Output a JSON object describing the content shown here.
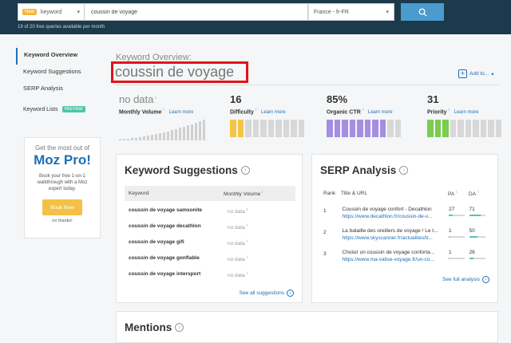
{
  "search": {
    "new_badge": "New",
    "type_value": "keyword",
    "query_value": "coussin de voyage",
    "locale_value": "France - fr-FR",
    "quota_text": "19 of 20 free queries available per month"
  },
  "sidebar": {
    "items": [
      {
        "label": "Keyword Overview"
      },
      {
        "label": "Keyword Suggestions"
      },
      {
        "label": "SERP Analysis"
      }
    ],
    "lists_label": "Keyword Lists",
    "preview_badge": "PREVIEW"
  },
  "promo": {
    "tagline": "Get the most out of",
    "title": "Moz Pro!",
    "text": "Book your free 1-on-1 walkthrough with a Moz expert today.",
    "button": "Book Now",
    "dismiss": "no thanks!"
  },
  "overview": {
    "heading": "Keyword Overview:",
    "keyword": "coussin de voyage",
    "add_to": "Add to..."
  },
  "metrics": {
    "learn_more": "Learn more",
    "monthly_volume": {
      "value": "no data",
      "label": "Monthly Volume"
    },
    "difficulty": {
      "value": "16",
      "label": "Difficulty",
      "filled": 2,
      "total": 10
    },
    "organic_ctr": {
      "value": "85%",
      "label": "Organic CTR",
      "filled": 8,
      "total": 10
    },
    "priority": {
      "value": "31",
      "label": "Priority",
      "filled": 3,
      "total": 10
    }
  },
  "colors": {
    "difficulty": "#f6c445",
    "organic_ctr": "#a58ee2",
    "priority": "#7ccc4e",
    "empty": "#d8d8d8"
  },
  "suggestions": {
    "title": "Keyword Suggestions",
    "col_keyword": "Keyword",
    "col_volume": "Monthly Volume",
    "rows": [
      {
        "keyword": "coussin de voyage samsonite",
        "volume": "no data"
      },
      {
        "keyword": "coussin de voyage decathlon",
        "volume": "no data"
      },
      {
        "keyword": "coussin de voyage gifi",
        "volume": "no data"
      },
      {
        "keyword": "coussin de voyage gonflable",
        "volume": "no data"
      },
      {
        "keyword": "coussin de voyage intersport",
        "volume": "no data"
      }
    ],
    "see_all": "See all suggestions"
  },
  "serp": {
    "title": "SERP Analysis",
    "col_rank": "Rank",
    "col_title": "Title & URL",
    "col_pa": "PA",
    "col_da": "DA",
    "rows": [
      {
        "rank": "1",
        "title": "Coussin de voyage confort - Decathlon",
        "url": "https://www.decathlon.fr/coussin-de-v...",
        "pa": "27",
        "da": "71",
        "pa_level": 0.27,
        "da_level": 0.71
      },
      {
        "rank": "2",
        "title": "La bataille des oreillers de voyage ! Le t...",
        "url": "https://www.skyscanner.fr/actualites/tr...",
        "pa": "1",
        "da": "50",
        "pa_level": 0.01,
        "da_level": 0.5
      },
      {
        "rank": "3",
        "title": "Choisir un coussin de voyage conforta...",
        "url": "https://www.ma-valise-voyage.fr/un-co...",
        "pa": "1",
        "da": "26",
        "pa_level": 0.01,
        "da_level": 0.26
      }
    ],
    "see_full": "See full analysis"
  },
  "mentions": {
    "title": "Mentions"
  }
}
